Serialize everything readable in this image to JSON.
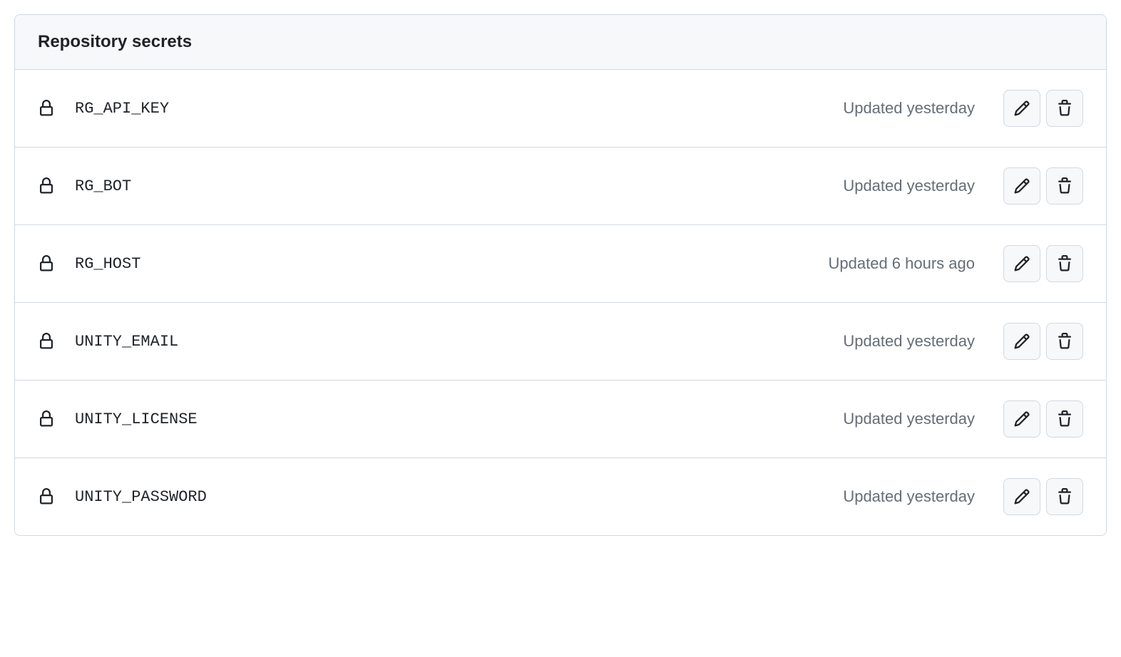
{
  "header": {
    "title": "Repository secrets"
  },
  "secrets": [
    {
      "name": "RG_API_KEY",
      "updated": "Updated yesterday"
    },
    {
      "name": "RG_BOT",
      "updated": "Updated yesterday"
    },
    {
      "name": "RG_HOST",
      "updated": "Updated 6 hours ago"
    },
    {
      "name": "UNITY_EMAIL",
      "updated": "Updated yesterday"
    },
    {
      "name": "UNITY_LICENSE",
      "updated": "Updated yesterday"
    },
    {
      "name": "UNITY_PASSWORD",
      "updated": "Updated yesterday"
    }
  ]
}
